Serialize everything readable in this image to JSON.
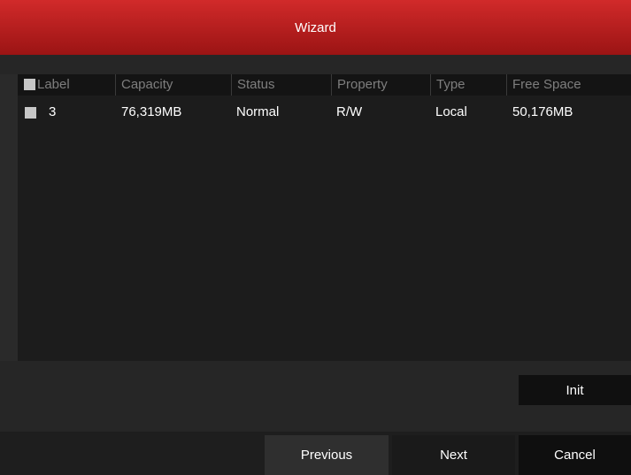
{
  "window": {
    "title": "Wizard"
  },
  "table": {
    "columns": [
      "Label",
      "Capacity",
      "Status",
      "Property",
      "Type",
      "Free Space"
    ],
    "rows": [
      {
        "label": "3",
        "capacity": "76,319MB",
        "status": "Normal",
        "property": "R/W",
        "type": "Local",
        "free_space": "50,176MB"
      }
    ]
  },
  "buttons": {
    "init": "Init",
    "previous": "Previous",
    "next": "Next",
    "cancel": "Cancel"
  }
}
